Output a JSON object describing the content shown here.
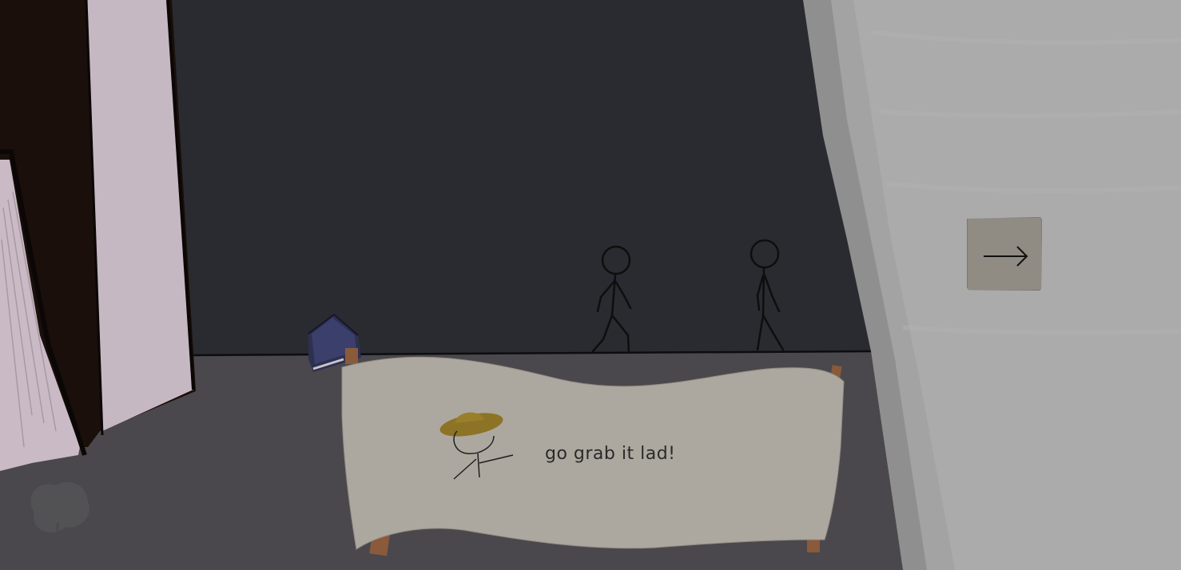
{
  "dialog": {
    "speaker_icon": "farmer-straw-hat-stickman-icon",
    "text": "go grab it lad!"
  },
  "navigation": {
    "next_icon": "arrow-right-icon"
  },
  "scene": {
    "background_color": "#2a2b30",
    "floor_color": "#4a484c",
    "banner_color": "#ada89f",
    "wall_color": "#a9a9a9"
  }
}
